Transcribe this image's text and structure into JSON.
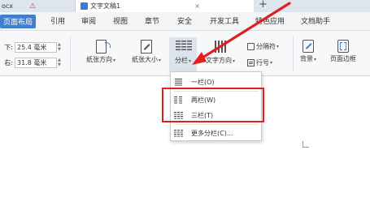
{
  "tabs": {
    "tab1": "ocx",
    "tab2": "文字文稿1",
    "close": "×",
    "new_tab": "+"
  },
  "menu": [
    "页面布局",
    "引用",
    "审阅",
    "视图",
    "章节",
    "安全",
    "开发工具",
    "特色应用",
    "文档助手"
  ],
  "margins": {
    "bottom_label": "下:",
    "bottom_value": "25.4 毫米",
    "right_label": "右:",
    "right_value": "31.8 毫米"
  },
  "ribbon": {
    "orientation": "纸张方向",
    "size": "纸张大小",
    "columns": "分栏",
    "text_direction": "文字方向",
    "separator": "分隔符",
    "line_number": "行号",
    "background": "背景",
    "page_border": "页面边框"
  },
  "dropdown": {
    "one": "一栏(O)",
    "two": "两栏(W)",
    "three": "三栏(T)",
    "more": "更多分栏(C)..."
  },
  "colors": {
    "accent": "#3f7fd0",
    "highlight": "#e02020"
  }
}
